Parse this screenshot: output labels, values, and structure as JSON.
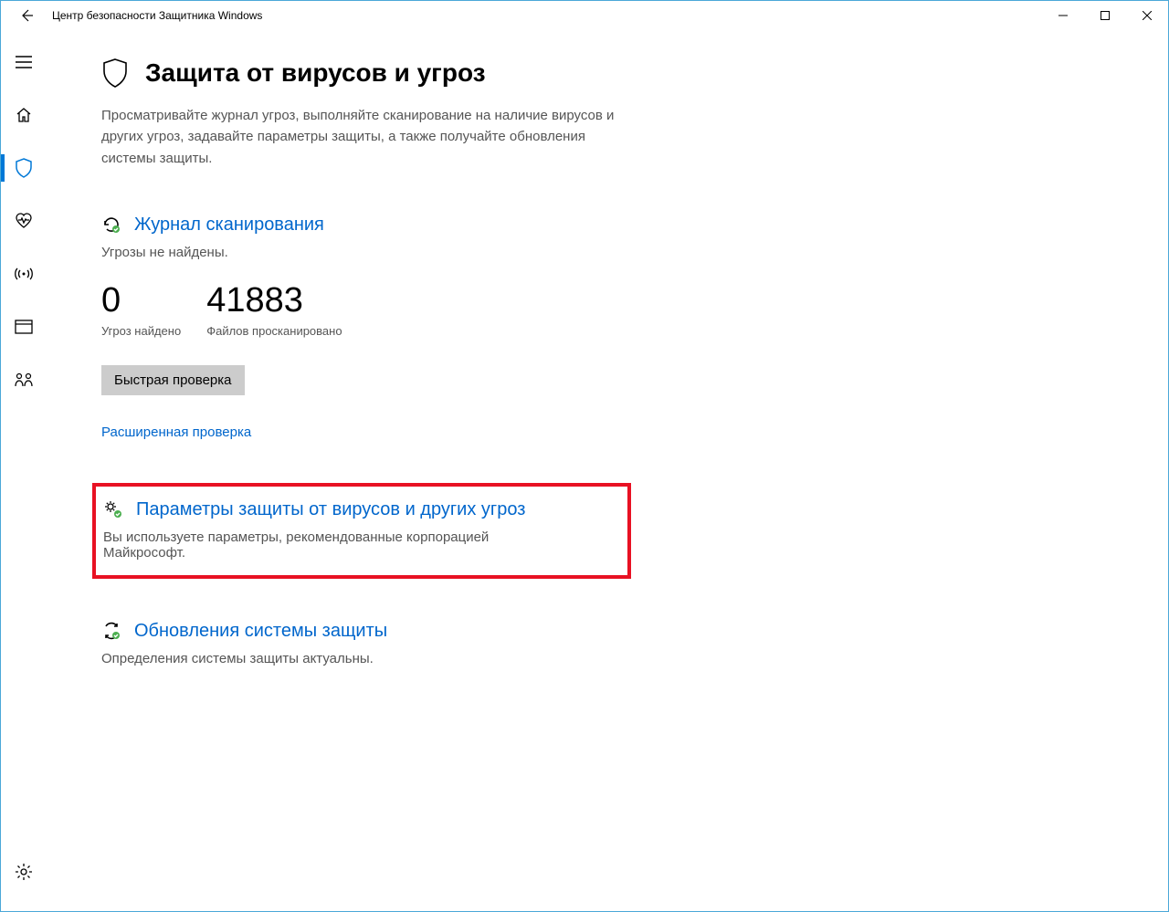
{
  "window": {
    "title": "Центр безопасности Защитника Windows"
  },
  "page": {
    "title": "Защита от вирусов и угроз",
    "description": "Просматривайте журнал угроз, выполняйте сканирование на наличие вирусов и других угроз, задавайте параметры защиты, а также получайте обновления системы защиты."
  },
  "scan_history": {
    "title": "Журнал сканирования",
    "subtitle": "Угрозы не найдены.",
    "threats_count": "0",
    "threats_label": "Угроз найдено",
    "files_count": "41883",
    "files_label": "Файлов просканировано",
    "quick_scan_button": "Быстрая проверка",
    "advanced_scan_link": "Расширенная проверка"
  },
  "protection_settings": {
    "title": "Параметры защиты от вирусов и других угроз",
    "subtitle": "Вы используете параметры, рекомендованные корпорацией Майкрософт."
  },
  "updates": {
    "title": "Обновления системы защиты",
    "subtitle": "Определения системы защиты актуальны."
  },
  "colors": {
    "accent": "#0078d7",
    "link": "#0066cc",
    "highlight": "#e81123"
  }
}
